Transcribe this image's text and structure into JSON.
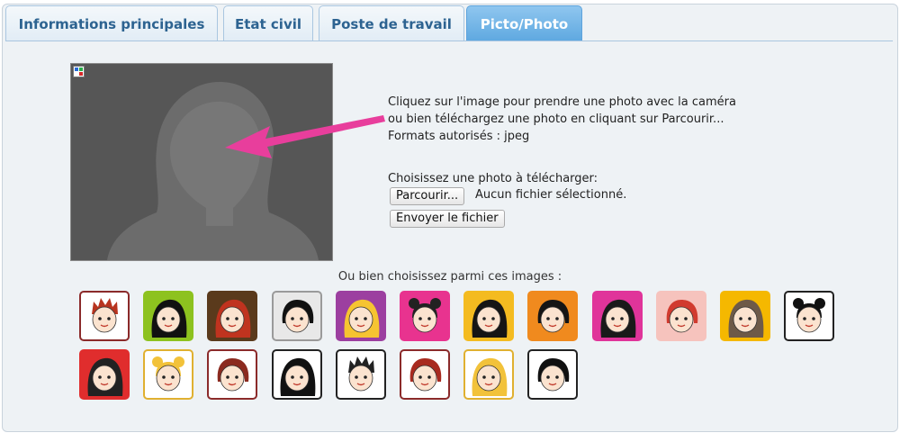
{
  "tabs": [
    {
      "label": "Informations principales",
      "active": false
    },
    {
      "label": "Etat civil",
      "active": false
    },
    {
      "label": "Poste de travail",
      "active": false
    },
    {
      "label": "Picto/Photo",
      "active": true
    }
  ],
  "camera": {
    "icon": "broken-image-icon",
    "overlay_icon": "pink-arrow-icon"
  },
  "info_lines": [
    "Cliquez sur l'image pour prendre une photo avec la caméra",
    "ou bien téléchargez une photo en cliquant sur Parcourir...",
    "Formats autorisés : jpeg"
  ],
  "upload": {
    "label": "Choisissez une photo à télécharger:",
    "browse_button": "Parcourir...",
    "no_file": "Aucun fichier sélectionné.",
    "send_button": "Envoyer le fichier"
  },
  "avatars_label": "Ou bien choisissez parmi ces images :",
  "avatars": [
    {
      "bg": "#ffffff",
      "border": "#8b2a2a",
      "hair": "#b8341f",
      "style": "spiky"
    },
    {
      "bg": "#8dc21f",
      "border": "#8dc21f",
      "hair": "#111111",
      "style": "long"
    },
    {
      "bg": "#5a3a1c",
      "border": "#5a3a1c",
      "hair": "#c0331f",
      "style": "long"
    },
    {
      "bg": "#e8e8e8",
      "border": "#9a9a9a",
      "hair": "#111111",
      "style": "bob"
    },
    {
      "bg": "#9c3fa0",
      "border": "#9c3fa0",
      "hair": "#f6c431",
      "style": "long"
    },
    {
      "bg": "#e8338f",
      "border": "#e8338f",
      "hair": "#222222",
      "style": "buns"
    },
    {
      "bg": "#f4bb20",
      "border": "#f4bb20",
      "hair": "#151515",
      "style": "long"
    },
    {
      "bg": "#f08a1e",
      "border": "#f08a1e",
      "hair": "#151515",
      "style": "bob"
    },
    {
      "bg": "#e0349a",
      "border": "#e0349a",
      "hair": "#1a1a1a",
      "style": "long"
    },
    {
      "bg": "#f6c3bd",
      "border": "#f6c3bd",
      "hair": "#d13b2f",
      "style": "bob"
    },
    {
      "bg": "#f5b800",
      "border": "#f5b800",
      "hair": "#6e5a48",
      "style": "long"
    },
    {
      "bg": "#ffffff",
      "border": "#222222",
      "hair": "#111111",
      "style": "buns"
    },
    {
      "bg": "#e02d2d",
      "border": "#e02d2d",
      "hair": "#222222",
      "style": "long"
    },
    {
      "bg": "#ffffff",
      "border": "#e0b030",
      "hair": "#f2c23a",
      "style": "buns"
    },
    {
      "bg": "#ffffff",
      "border": "#8b2a2a",
      "hair": "#8b2a1f",
      "style": "bob"
    },
    {
      "bg": "#ffffff",
      "border": "#222222",
      "hair": "#111111",
      "style": "long"
    },
    {
      "bg": "#ffffff",
      "border": "#222222",
      "hair": "#222222",
      "style": "spiky"
    },
    {
      "bg": "#ffffff",
      "border": "#8b2a2a",
      "hair": "#a82a1f",
      "style": "bob"
    },
    {
      "bg": "#ffffff",
      "border": "#e0b030",
      "hair": "#f2c23a",
      "style": "long"
    },
    {
      "bg": "#ffffff",
      "border": "#222222",
      "hair": "#111111",
      "style": "bob"
    }
  ],
  "colors": {
    "tab_active": "#5ea8e0",
    "tab_text": "#2d6391",
    "arrow": "#e83e9c"
  }
}
